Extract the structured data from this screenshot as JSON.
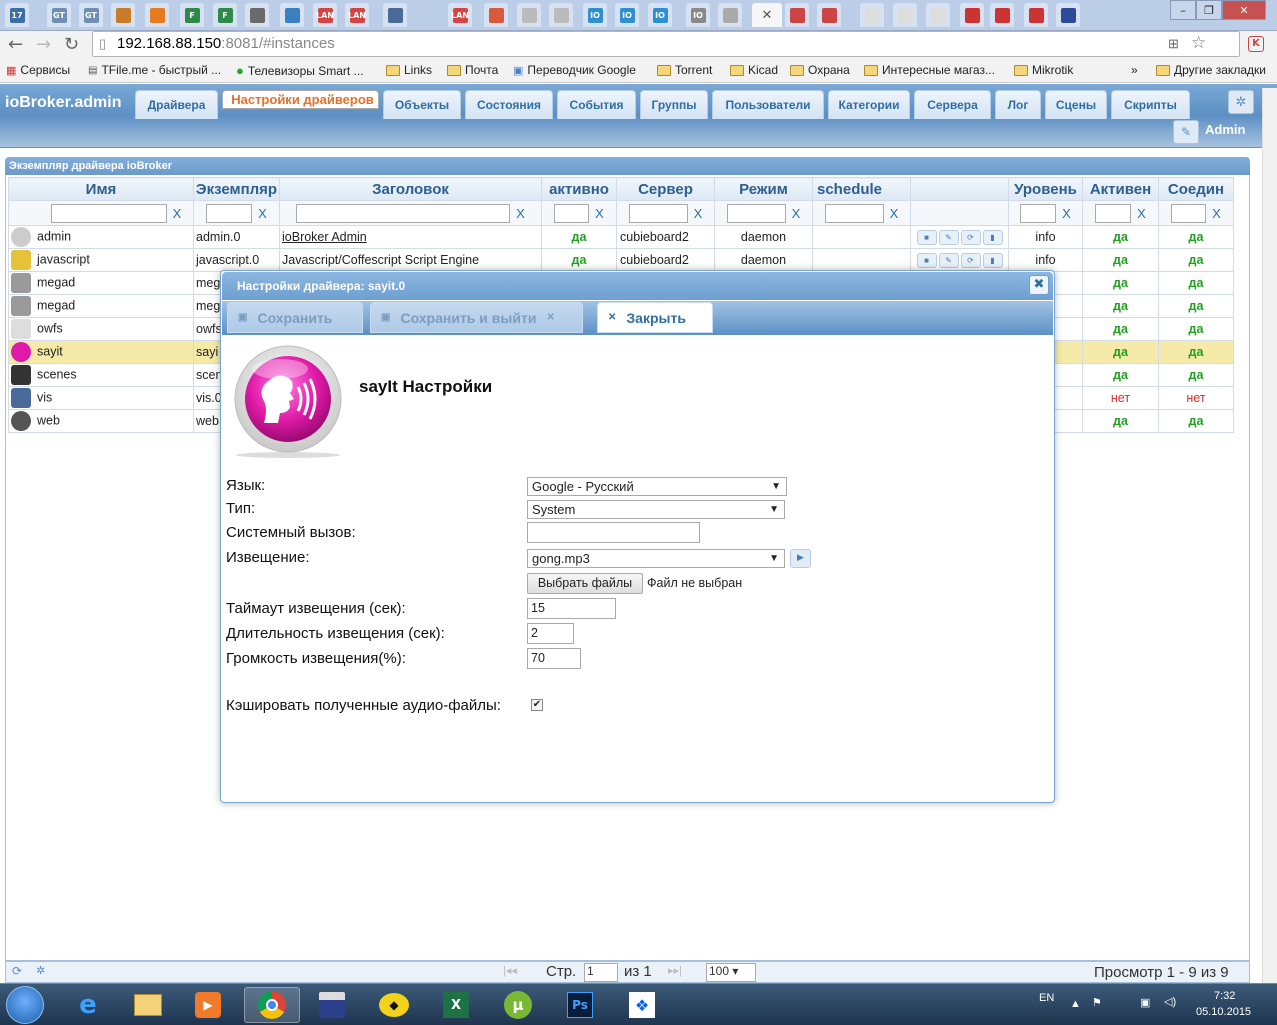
{
  "browser": {
    "url_host": "192.168.88.150",
    "url_port": ":8081",
    "url_path": "/#instances",
    "tab_favicons": [
      "17",
      "GT",
      "GT",
      "",
      "",
      "F",
      "F",
      "",
      "",
      "LAN",
      "LAN",
      "",
      "LAN",
      "",
      "",
      "",
      "IO",
      "IO",
      "IO",
      "IO",
      "",
      "",
      "",
      "",
      "",
      "",
      "",
      "",
      "",
      "",
      "",
      ""
    ],
    "bookmarks": [
      "Сервисы",
      "TFile.me - быстрый ...",
      "Телевизоры Smart ...",
      "Links",
      "Почта",
      "Переводчик Google",
      "Torrent",
      "Kicad",
      "Охрана",
      "Интересные магаз...",
      "Mikrotik"
    ],
    "bookmarks_more": "»",
    "other_bookmarks": "Другие закладки"
  },
  "app": {
    "brand": "ioBroker.admin",
    "tabs": [
      "Драйвера",
      "Настройки драйверов",
      "Объекты",
      "Состояния",
      "События",
      "Группы",
      "Пользователи",
      "Категории",
      "Сервера",
      "Лог",
      "Сцены",
      "Скрипты"
    ],
    "selected_tab": "Настройки драйверов",
    "user": "Admin"
  },
  "grid": {
    "caption": "Экземпляр драйвера ioBroker",
    "columns": [
      "Имя",
      "Экземпляр",
      "Заголовок",
      "активно",
      "Сервер",
      "Режим",
      "schedule",
      "",
      "Уровень",
      "Активен",
      "Соедин"
    ],
    "filter_x": "X",
    "rows": [
      {
        "name": "admin",
        "icon": "gear-icon",
        "instance": "admin.0",
        "title": "ioBroker Admin",
        "active": "да",
        "server": "cubieboard2",
        "mode": "daemon",
        "level": "info",
        "alive": "да",
        "connected": "да"
      },
      {
        "name": "javascript",
        "icon": "js-icon",
        "instance": "javascript.0",
        "title": "Javascript/Coffescript Script Engine",
        "active": "да",
        "server": "cubieboard2",
        "mode": "daemon",
        "level": "info",
        "alive": "да",
        "connected": "да"
      },
      {
        "name": "megad",
        "icon": "board-icon",
        "instance": "meg",
        "title": "",
        "active": "",
        "server": "",
        "mode": "",
        "level": "",
        "alive": "да",
        "connected": "да"
      },
      {
        "name": "megad",
        "icon": "board-icon",
        "instance": "meg",
        "title": "",
        "active": "",
        "server": "",
        "mode": "",
        "level": "",
        "alive": "да",
        "connected": "да"
      },
      {
        "name": "owfs",
        "icon": "owfs-icon",
        "instance": "owfs",
        "title": "",
        "active": "",
        "server": "",
        "mode": "",
        "level": "",
        "alive": "да",
        "connected": "да"
      },
      {
        "name": "sayit",
        "icon": "sayit-icon",
        "instance": "sayi",
        "title": "",
        "active": "",
        "server": "",
        "mode": "",
        "level": "",
        "alive": "да",
        "connected": "да"
      },
      {
        "name": "scenes",
        "icon": "scenes-icon",
        "instance": "scen",
        "title": "",
        "active": "",
        "server": "",
        "mode": "",
        "level": "",
        "alive": "да",
        "connected": "да"
      },
      {
        "name": "vis",
        "icon": "vis-icon",
        "instance": "vis.0",
        "title": "",
        "active": "",
        "server": "",
        "mode": "",
        "level": "",
        "alive": "нет",
        "connected": "нет"
      },
      {
        "name": "web",
        "icon": "www-icon",
        "instance": "web",
        "title": "",
        "active": "",
        "server": "",
        "mode": "",
        "level": "",
        "alive": "да",
        "connected": "да"
      }
    ],
    "pager": {
      "page_label": "Стр.",
      "page": "1",
      "of_label": "из 1",
      "rows_per_page": "100",
      "summary": "Просмотр 1 - 9 из 9"
    }
  },
  "dialog": {
    "title": "Настройки драйвера: sayit.0",
    "save": "Сохранить",
    "save_exit": "Сохранить и выйти",
    "close": "Закрыть",
    "heading": "sayIt Настройки",
    "fields": {
      "language_label": "Язык:",
      "language_value": "Google - Русский",
      "type_label": "Тип:",
      "type_value": "System",
      "syscall_label": "Системный вызов:",
      "syscall_value": "",
      "announce_label": "Извещение:",
      "announce_value": "gong.mp3",
      "file_button": "Выбрать файлы",
      "file_status": "Файл не выбран",
      "timeout_label": "Таймаут извещения (сек):",
      "timeout_value": "15",
      "duration_label": "Длительность извещения (сек):",
      "duration_value": "2",
      "volume_label": "Громкость извещения(%):",
      "volume_value": "70",
      "cache_label": "Кэшировать полученные аудио-файлы:",
      "cache_checked": true
    }
  },
  "taskbar": {
    "lang": "EN",
    "time": "7:32",
    "date": "05.10.2015"
  }
}
